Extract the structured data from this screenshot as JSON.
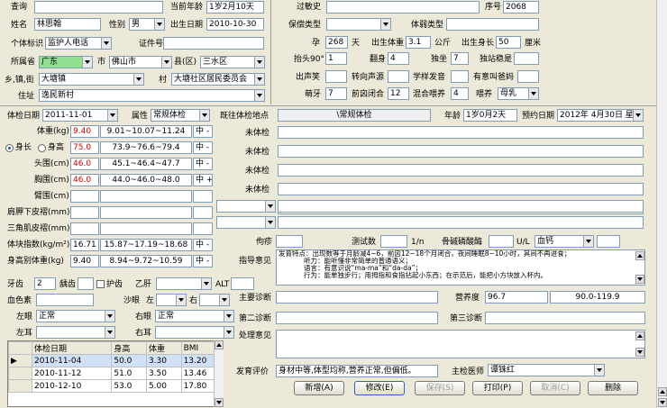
{
  "top": {
    "query_label": "查询",
    "query_value": "",
    "cur_age_label": "当前年龄",
    "cur_age": "1岁2月10天",
    "allergy_label": "过敏史",
    "allergy": "",
    "seq_label": "序号",
    "seq": "2068",
    "name_label": "姓名",
    "name": "林思翰",
    "sex_label": "性别",
    "sex": "男",
    "dob_label": "出生日期",
    "dob": "2010-10-30",
    "id_label": "个体标识",
    "id_value": "监护人电话",
    "cert_label": "证件号",
    "cert": "",
    "prov_label": "所属省",
    "prov": "广东",
    "city_label": "市",
    "city": "佛山市",
    "county_label": "县(区)",
    "county": "三水区",
    "town_label": "乡,镇,街",
    "town": "大塘镇",
    "village_label": "村",
    "village": "大塘社区居民委员会",
    "addr_label": "住址",
    "addr": "逸民新村",
    "ins_label": "保偿类型",
    "ins": "",
    "bodytype_label": "体弱类型",
    "bodytype": "",
    "preg_label": "孕",
    "preg": "268",
    "day_unit": "天",
    "bw_label": "出生体重",
    "bw": "3.1",
    "kg_unit": "公斤",
    "bl_label": "出生身长",
    "bl": "50",
    "cm_unit": "厘米",
    "head90_label": "抬头90°",
    "head90": "1",
    "roll_label": "翻身",
    "roll": "4",
    "sit_label": "独坐",
    "sit": "7",
    "stand_label": "独站稳是",
    "stand": "",
    "sound_label": "出声笑",
    "sound": "",
    "turn_label": "转向声源",
    "turn": "",
    "babble_label": "学样发音",
    "babble": "",
    "meaning_label": "有意叫爸妈",
    "meaning": "",
    "teeth_label": "萌牙",
    "teeth": "7",
    "font_label": "前囟闭合",
    "font": "12",
    "mix_label": "混合喂养",
    "mix": "4",
    "feed_label": "喂养",
    "feed": "母乳"
  },
  "exam": {
    "date_label": "体检日期",
    "date": "2011-11-01",
    "attr_label": "属性",
    "attr": "常规体检",
    "prev_label": "既往体检地点",
    "prev": "\\常规体检",
    "age_label": "年龄",
    "age": "1岁0月2天",
    "appt_label": "预约日期",
    "appt": "2012年 4月30日 星期一"
  },
  "metrics": [
    {
      "label": "体重(kg)",
      "val": "9.40",
      "red": true,
      "range": "9.01~10.07~11.24",
      "grade": "中 -"
    },
    {
      "label": "身高",
      "val": "75.0",
      "red": true,
      "range": "73.9~76.6~79.4",
      "grade": "中 -"
    },
    {
      "label": "头围(cm)",
      "val": "46.0",
      "red": true,
      "range": "45.1~46.4~47.7",
      "grade": "中 -"
    },
    {
      "label": "胸围(cm)",
      "val": "46.0",
      "red": true,
      "range": "44.0~46.0~48.0",
      "grade": "中 +"
    },
    {
      "label": "臂围(cm)",
      "val": "",
      "red": false,
      "range": "",
      "grade": ""
    },
    {
      "label": "肩胛下皮褶(mm)",
      "val": "",
      "red": false,
      "range": "",
      "grade": ""
    },
    {
      "label": "三角肌皮褶(mm)",
      "val": "",
      "red": false,
      "range": "",
      "grade": ""
    },
    {
      "label": "体块指数(kg/m²)",
      "val": "16.71",
      "red": false,
      "range": "15.87~17.19~18.68",
      "grade": "中 -"
    },
    {
      "label": "身高别体重(kg)",
      "val": "9.40",
      "red": false,
      "range": "8.94~9.72~10.59",
      "grade": "中 -"
    }
  ],
  "radio": {
    "a": "身长",
    "b": "身高"
  },
  "notes": [
    "未体检",
    "未体检",
    "未体检",
    "未体检",
    "未体检"
  ],
  "lab": {
    "rickets_label": "佝疹",
    "test_label": "测试数",
    "unit_ln": "1/n",
    "marrow_label": "骨碱磷酸酶",
    "unit_ul": "U/L",
    "ca": "血钙"
  },
  "guide_label": "指导意见",
  "guide": [
    "发育特点：出现数等于月龄减4~6，前囟12~18个月闭合，夜间睡眠8~10小时，其间不再进食；",
    "听力：能听懂非常简单的普通语义；",
    "语言：有意识说“ma-ma”和“da-da”；",
    "行为：能单独步行；用拇指和食指拈起小东西；在示范后，能把小方块放入杯内。"
  ],
  "misc": {
    "teeth_label": "牙齿",
    "teeth": "2",
    "caries_label": "龋齿",
    "caries": "",
    "fluoride_label": "护齿",
    "liver_label": "乙肝",
    "liver": "",
    "alt_label": "ALT",
    "alt": "",
    "hb_label": "血色素",
    "hb": "",
    "eyelid_label": "沙眼",
    "left_label": "左",
    "right_label": "右",
    "leye_label": "左眼",
    "leye": "正常",
    "reye_label": "右眼",
    "reye": "正常",
    "lear_label": "左耳",
    "lear": "",
    "rear_label": "右耳",
    "rear": ""
  },
  "diag": {
    "main_label": "主要诊断",
    "main": "",
    "nutri_label": "营养度",
    "nutri": "96.7",
    "nutri_range": "90.0-119.9",
    "second_label": "第二诊断",
    "second": "",
    "third_label": "第三诊断",
    "third": "",
    "handle_label": "处理意见",
    "handle": ""
  },
  "history": {
    "headers": [
      "体检日期",
      "身高",
      "体重",
      "BMI"
    ],
    "rows": [
      [
        "2010-11-04",
        "50.0",
        "3.30",
        "13.20"
      ],
      [
        "2010-11-12",
        "51.0",
        "3.50",
        "13.46"
      ],
      [
        "2010-12-10",
        "53.0",
        "5.00",
        "17.80"
      ]
    ]
  },
  "footer": {
    "eval_label": "发育评价",
    "eval": "身材中等,体型均称,营养正常,但偏低。",
    "doctor_label": "主检医师",
    "doctor": "谭铢红"
  },
  "buttons": {
    "add": "新增(A)",
    "edit": "修改(E)",
    "save": "保存(S)",
    "print": "打印(P)",
    "cancel": "取消(C)",
    "delete": "删除"
  }
}
